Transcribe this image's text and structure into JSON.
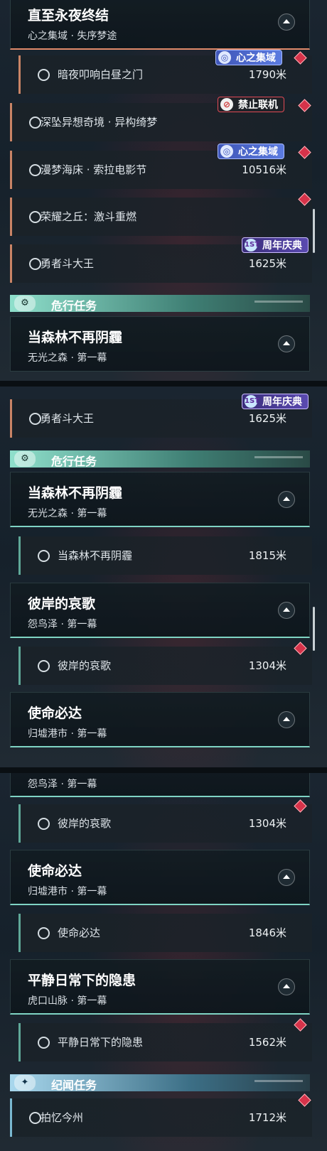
{
  "quest_chain_1": {
    "title": "直至永夜终结",
    "subtitle": "心之集域 · 失序梦途"
  },
  "quests": {
    "q1": {
      "name": "暗夜叩响白昼之门",
      "distance": "1790米",
      "badge": "心之集域"
    },
    "q2": {
      "name": "深坠异想奇境 · 异构绮梦",
      "distance": "",
      "badge": "禁止联机"
    },
    "q3": {
      "name": "漫梦海床 · 索拉电影节",
      "distance": "10516米",
      "badge": "心之集域"
    },
    "q4": {
      "name": "荣耀之丘：激斗重燃",
      "distance": ""
    },
    "q5": {
      "name": "勇者斗大王",
      "distance": "1625米",
      "badge": "周年庆典"
    },
    "q6": {
      "name": "当森林不再阴霾",
      "distance": "1815米"
    },
    "q7": {
      "name": "彼岸的哀歌",
      "distance": "1304米"
    },
    "q8": {
      "name": "使命必达",
      "distance": "1846米"
    },
    "q9": {
      "name": "平静日常下的隐患",
      "distance": "1562米"
    },
    "q10": {
      "name": "拍忆今州",
      "distance": "1712米"
    }
  },
  "sections": {
    "danger": "危行任务",
    "chronicle": "纪闻任务"
  },
  "chains": {
    "forest": {
      "title": "当森林不再阴霾",
      "subtitle": "无光之森 · 第一幕"
    },
    "elegy": {
      "title": "彼岸的哀歌",
      "subtitle": "怨鸟泽 · 第一幕"
    },
    "mission": {
      "title": "使命必达",
      "subtitle": "归墟港市 · 第一幕"
    },
    "calm": {
      "title": "平静日常下的隐患",
      "subtitle": "虎口山脉 · 第一幕"
    }
  },
  "icons": {
    "fest": "1ST"
  },
  "colors": {
    "accent_orange": "#e08a6a",
    "accent_teal": "#7fd4c4",
    "marker_red": "#d6334a"
  }
}
